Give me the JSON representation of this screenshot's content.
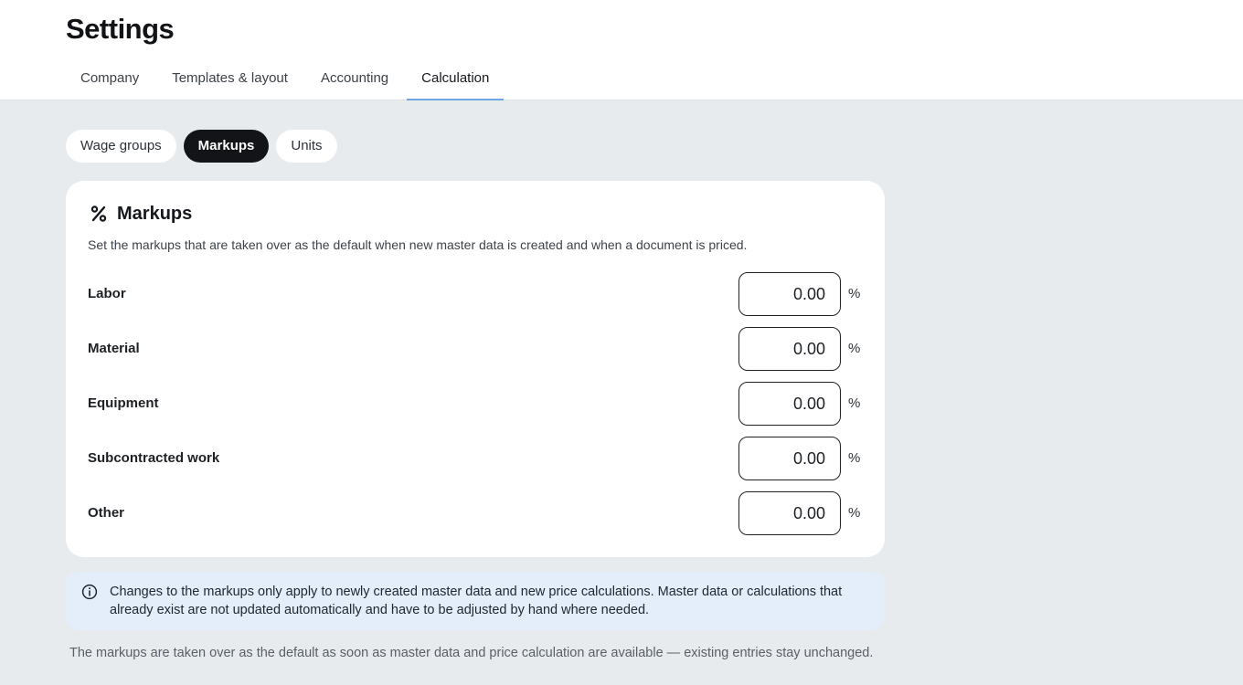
{
  "header": {
    "title": "Settings",
    "tabs": [
      {
        "label": "Company"
      },
      {
        "label": "Templates & layout"
      },
      {
        "label": "Accounting"
      },
      {
        "label": "Calculation"
      }
    ],
    "active_tab": "Calculation"
  },
  "subtabs": {
    "items": [
      {
        "label": "Wage groups"
      },
      {
        "label": "Markups"
      },
      {
        "label": "Units"
      }
    ],
    "active": "Markups"
  },
  "card": {
    "icon": "percent-icon",
    "title": "Markups",
    "description": "Set the markups that are taken over as the default when new master data is created and when a document is priced.",
    "rows": [
      {
        "label": "Labor",
        "value": "0.00",
        "unit": "%"
      },
      {
        "label": "Material",
        "value": "0.00",
        "unit": "%"
      },
      {
        "label": "Equipment",
        "value": "0.00",
        "unit": "%"
      },
      {
        "label": "Subcontracted work",
        "value": "0.00",
        "unit": "%"
      },
      {
        "label": "Other",
        "value": "0.00",
        "unit": "%"
      }
    ]
  },
  "info": {
    "icon": "info-icon",
    "text": "Changes to the markups only apply to newly created master data and new price calculations. Master data or calculations that already exist are not updated automatically and have to be adjusted by hand where needed."
  },
  "footnote": "The markups are taken over as the default as soon as master data and price calculation are available — existing entries stay unchanged.",
  "colors": {
    "background": "#e8ebee",
    "active_tab_underline": "#6ea8e0",
    "active_pill": "#121417",
    "info_background": "#e3eefa"
  }
}
